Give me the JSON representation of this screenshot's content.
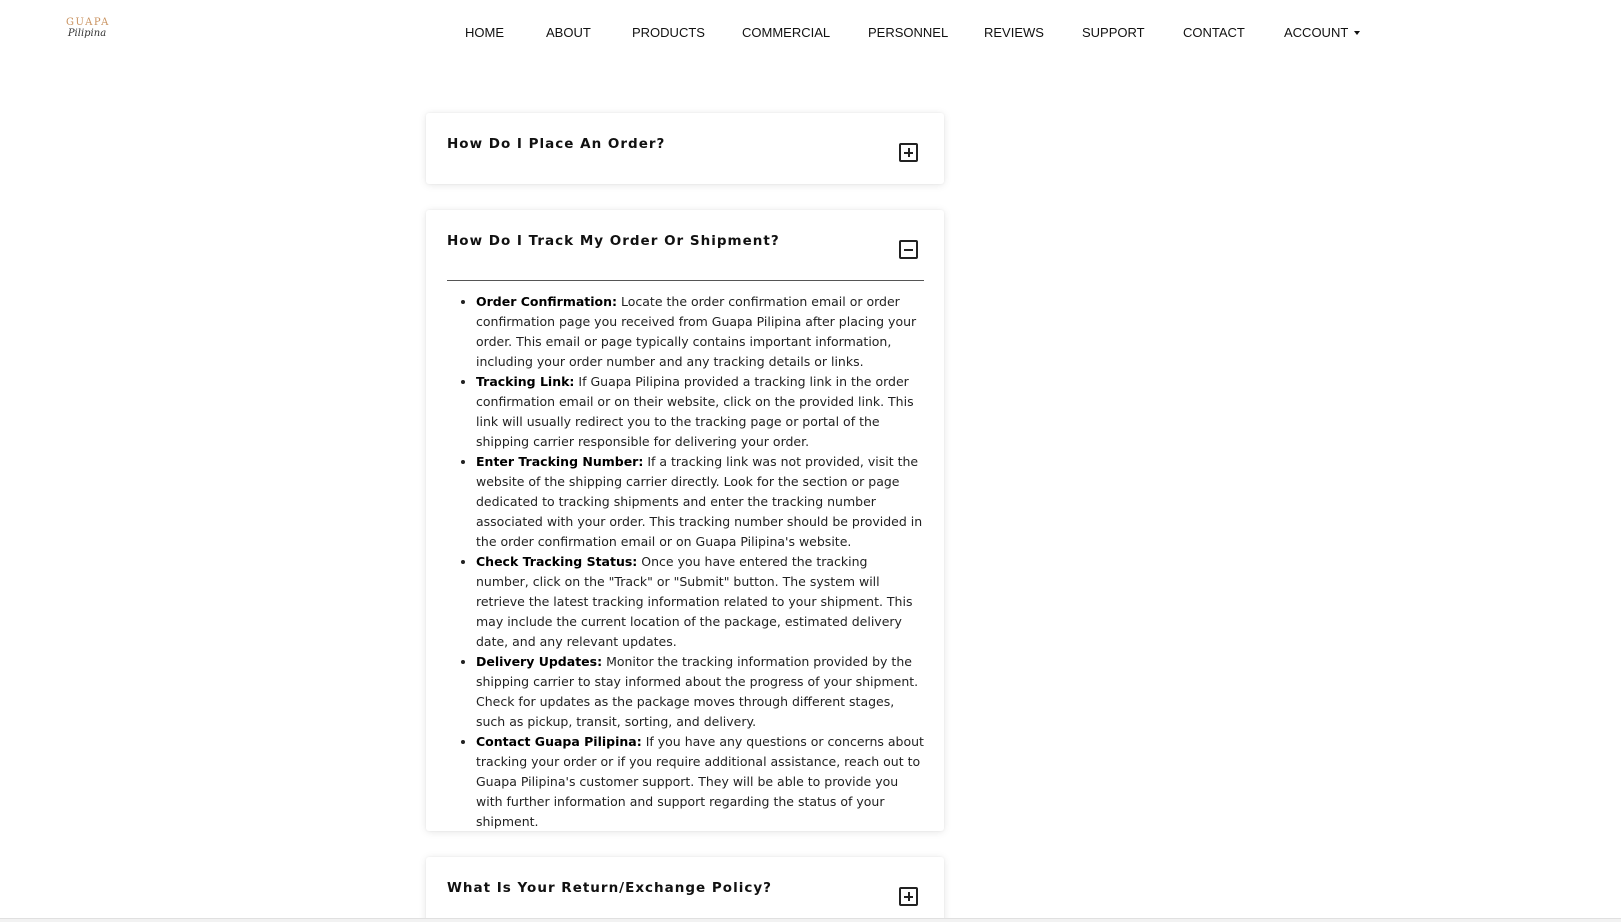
{
  "logo": {
    "line1": "GUAPA",
    "line2": "Pilipina"
  },
  "nav": {
    "home": "HOME",
    "about": "ABOUT",
    "products": "PRODUCTS",
    "commercial": "COMMERCIAL",
    "personnel": "PERSONNEL",
    "reviews": "REVIEWS",
    "support": "SUPPORT",
    "contact": "CONTACT",
    "account": "ACCOUNT"
  },
  "faq": [
    {
      "question": "How Do I Place An Order?",
      "state": "collapsed",
      "toggle_icon": "plus-square-icon"
    },
    {
      "question": "How Do I Track My Order Or Shipment?",
      "state": "expanded",
      "toggle_icon": "minus-square-icon",
      "items": [
        {
          "title": "Order Confirmation:",
          "text": " Locate the order confirmation email or order confirmation page you received from Guapa Pilipina after placing your order. This email or page typically contains important information, including your order number and any tracking details or links."
        },
        {
          "title": "Tracking Link:",
          "text": " If Guapa Pilipina provided a tracking link in the order confirmation email or on their website, click on the provided link. This link will usually redirect you to the tracking page or portal of the shipping carrier responsible for delivering your order."
        },
        {
          "title": "Enter Tracking Number:",
          "text": " If a tracking link was not provided, visit the website of the shipping carrier directly. Look for the section or page dedicated to tracking shipments and enter the tracking number associated with your order. This tracking number should be provided in the order confirmation email or on Guapa Pilipina's website."
        },
        {
          "title": "Check Tracking Status:",
          "text": " Once you have entered the tracking number, click on the \"Track\" or \"Submit\" button. The system will retrieve the latest tracking information related to your shipment. This may include the current location of the package, estimated delivery date, and any relevant updates."
        },
        {
          "title": "Delivery Updates:",
          "text": " Monitor the tracking information provided by the shipping carrier to stay informed about the progress of your shipment. Check for updates as the package moves through different stages, such as pickup, transit, sorting, and delivery."
        },
        {
          "title": "Contact Guapa Pilipina:",
          "text": " If you have any questions or concerns about tracking your order or if you require additional assistance, reach out to Guapa Pilipina's customer support. They will be able to provide you with further information and support regarding the status of your shipment."
        }
      ]
    },
    {
      "question": "What Is Your Return/Exchange Policy?",
      "state": "collapsed",
      "toggle_icon": "plus-square-icon"
    }
  ]
}
